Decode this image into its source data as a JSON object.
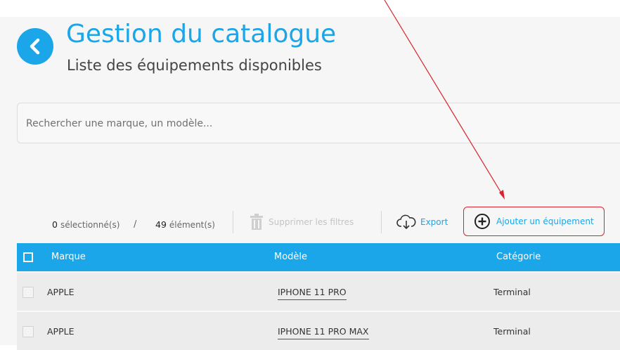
{
  "header": {
    "title": "Gestion du catalogue",
    "subtitle": "Liste des équipements disponibles"
  },
  "search": {
    "placeholder": "Rechercher une marque, un modèle..."
  },
  "toolbar": {
    "selected_count": "0",
    "selected_unit": "sélectionné(s)",
    "separator": "/",
    "total_count": "49",
    "total_unit": "élément(s)",
    "clear_filters_label": "Supprimer les filtres",
    "export_label": "Export",
    "add_label": "Ajouter un équipement"
  },
  "table": {
    "columns": [
      "Marque",
      "Modèle",
      "Catégorie"
    ],
    "rows": [
      {
        "brand": "APPLE",
        "model": "IPHONE 11 PRO",
        "category": "Terminal"
      },
      {
        "brand": "APPLE",
        "model": "IPHONE 11 PRO MAX",
        "category": "Terminal"
      }
    ]
  },
  "colors": {
    "accent": "#1aa6e8",
    "highlight": "#d9232d"
  },
  "icons": {
    "back": "chevron-left-icon",
    "trash": "trash-icon",
    "export": "cloud-download-icon",
    "add": "plus-circle-icon"
  }
}
